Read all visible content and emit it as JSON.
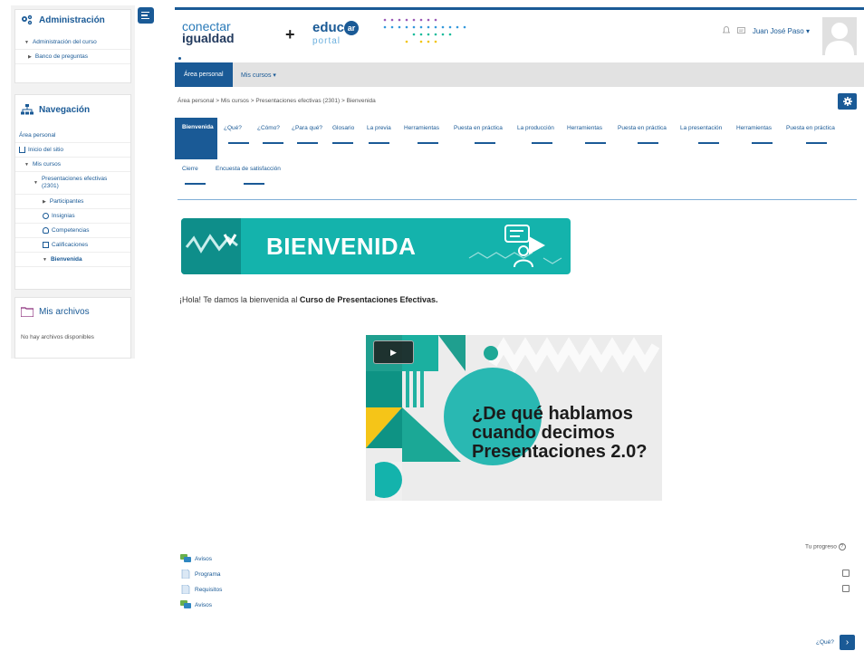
{
  "sidebar": {
    "admin": {
      "title": "Administración",
      "items": [
        "Administración del curso",
        "Banco de preguntas"
      ]
    },
    "navigation": {
      "title": "Navegación",
      "items": [
        "Área personal",
        "Inicio del sitio",
        "Mis cursos",
        "Presentaciones efectivas (2301)",
        "Participantes",
        "Insignias",
        "Competencias",
        "Calificaciones",
        "Bienvenida"
      ]
    },
    "files": {
      "title": "Mis archivos",
      "empty": "No hay archivos disponibles"
    }
  },
  "header": {
    "logo_conectar_1": "conectar",
    "logo_conectar_2": "igualdad",
    "plus": "+",
    "logo_educ": "educ",
    "logo_ar": "ar",
    "logo_portal": "portal",
    "user_name": "Juan José Paso"
  },
  "navbar": {
    "active": "Área personal",
    "courses": "Mis cursos ▾"
  },
  "breadcrumb": "Área personal > Mis cursos > Presentaciones efectivas (2301) > Bienvenida",
  "tabs": [
    "Bienvenida",
    "¿Qué?",
    "¿Cómo?",
    "¿Para qué?",
    "Glosario",
    "La previa",
    "Herramientas",
    "Puesta en práctica",
    "La producción",
    "Herramientas",
    "Puesta en práctica",
    "La presentación",
    "Herramientas",
    "Puesta en práctica",
    "Cierre",
    "Encuesta de satisfacción"
  ],
  "banner_title": "BIENVENIDA",
  "welcome": {
    "prefix": "¡Hola! Te damos la bienvenida al ",
    "course": "Curso de Presentaciones Efectivas."
  },
  "video": {
    "title_line1": "¿De qué hablamos",
    "title_line2": "cuando decimos",
    "title_line3": "Presentaciones 2.0?"
  },
  "progress_label": "Tu progreso",
  "activities": [
    "Avisos",
    "Programa",
    "Requisitos",
    "Avisos"
  ],
  "next": {
    "label": "¿Qué?",
    "arrow": "›"
  },
  "colors": {
    "primary": "#1a5a96",
    "teal": "#14b3ac",
    "nav_bg": "#e2e2e2"
  }
}
